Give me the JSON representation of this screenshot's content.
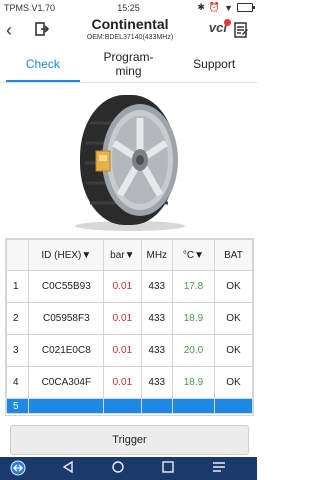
{
  "status_bar": {
    "app_version": "TPMS V1.70",
    "time": "15:25",
    "icons": [
      "bluetooth-icon",
      "alarm-icon",
      "wifi-icon",
      "battery-icon"
    ]
  },
  "header": {
    "title": "Continental",
    "subtitle": "OEM:BDEL37140(433MHz)",
    "vci_label": "vci"
  },
  "tabs": [
    {
      "label": "Check",
      "active": true
    },
    {
      "label": "Program-\nming",
      "active": false
    },
    {
      "label": "Support",
      "active": false
    }
  ],
  "table": {
    "headers": [
      "",
      "ID (HEX)▼",
      "bar▼",
      "MHz",
      "°C▼",
      "BAT"
    ],
    "rows": [
      {
        "index": "1",
        "id": "C0C55B93",
        "bar": "0.01",
        "mhz": "433",
        "temp": "17.8",
        "bat": "OK"
      },
      {
        "index": "2",
        "id": "C05958F3",
        "bar": "0.01",
        "mhz": "433",
        "temp": "18.9",
        "bat": "OK"
      },
      {
        "index": "3",
        "id": "C021E0C8",
        "bar": "0.01",
        "mhz": "433",
        "temp": "20.0",
        "bat": "OK"
      },
      {
        "index": "4",
        "id": "C0CA304F",
        "bar": "0.01",
        "mhz": "433",
        "temp": "18.9",
        "bat": "OK"
      },
      {
        "index": "5",
        "id": "",
        "bar": "",
        "mhz": "",
        "temp": "",
        "bat": ""
      }
    ]
  },
  "trigger_label": "Trigger",
  "colors": {
    "accent": "#1e88e5",
    "pressure": "#d32f2f",
    "temperature": "#43a047",
    "navbar": "#1a3a6b"
  }
}
